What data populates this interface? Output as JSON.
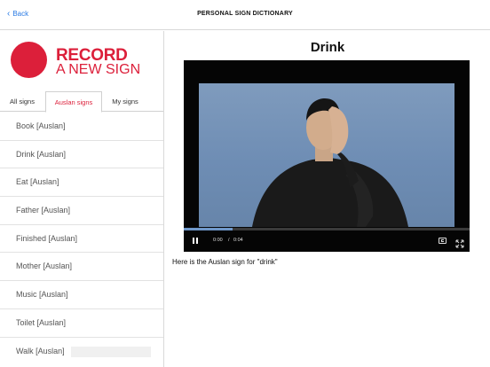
{
  "header": {
    "back_label": "Back",
    "title": "PERSONAL SIGN DICTIONARY"
  },
  "sidebar": {
    "record": {
      "line1": "RECORD",
      "line2": "A NEW SIGN",
      "accent_color": "#dc1f3a"
    },
    "tabs": [
      {
        "label": "All signs",
        "active": false
      },
      {
        "label": "Auslan signs",
        "active": true
      },
      {
        "label": "My signs",
        "active": false
      }
    ],
    "items": [
      {
        "label": "Book [Auslan]"
      },
      {
        "label": "Drink [Auslan]"
      },
      {
        "label": "Eat [Auslan]"
      },
      {
        "label": "Father [Auslan]"
      },
      {
        "label": "Finished [Auslan]"
      },
      {
        "label": "Mother [Auslan]"
      },
      {
        "label": "Music [Auslan]"
      },
      {
        "label": "Toilet [Auslan]"
      },
      {
        "label": "Walk [Auslan]"
      }
    ]
  },
  "main": {
    "sign_title": "Drink",
    "video": {
      "current_time": "0:00",
      "separator": "/",
      "duration": "0:04",
      "progress": 0.17
    },
    "caption": "Here is the Auslan sign for \"drink\""
  },
  "icons": {
    "back": "chevron-left-icon",
    "play_state": "pause-icon",
    "captions": "closed-captions-icon",
    "fullscreen": "fullscreen-icon"
  },
  "colors": {
    "link": "#2a7be4",
    "accent": "#dc1f3a"
  }
}
